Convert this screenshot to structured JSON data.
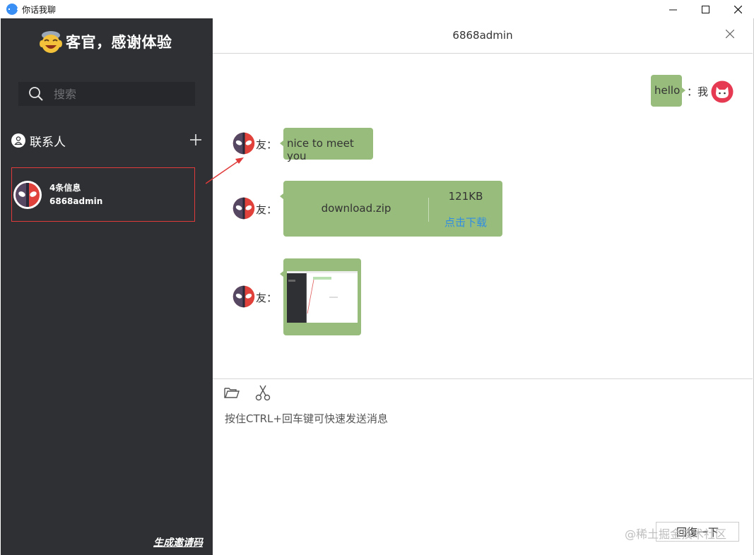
{
  "window": {
    "title": "你话我聊"
  },
  "sidebar": {
    "greeting": "客官，感谢体验",
    "search": {
      "placeholder": "搜索"
    },
    "contacts_title": "联系人",
    "contact": {
      "unread": "4条信息",
      "name": "6868admin"
    },
    "invite_link": "生成邀请码"
  },
  "chat": {
    "title": "6868admin",
    "messages": [
      {
        "from": "me",
        "text": "hello",
        "label": "：我"
      },
      {
        "from": "friend",
        "text": "nice to meet you",
        "label": "友："
      },
      {
        "from": "friend",
        "label": "友：",
        "file": {
          "name": "download.zip",
          "size": "121KB",
          "action": "点击下载"
        }
      },
      {
        "from": "friend",
        "label": "友：",
        "image": "screenshot-thumbnail"
      }
    ]
  },
  "composer": {
    "placeholder": "按住CTRL+回车键可快速发送消息",
    "send_label": "回復一下",
    "watermark": "@稀土掘金技术社区"
  },
  "colors": {
    "sidebar": "#2e3033",
    "bubble": "#98bc7c",
    "link": "#2f8de4",
    "highlight": "#e03a3a"
  }
}
